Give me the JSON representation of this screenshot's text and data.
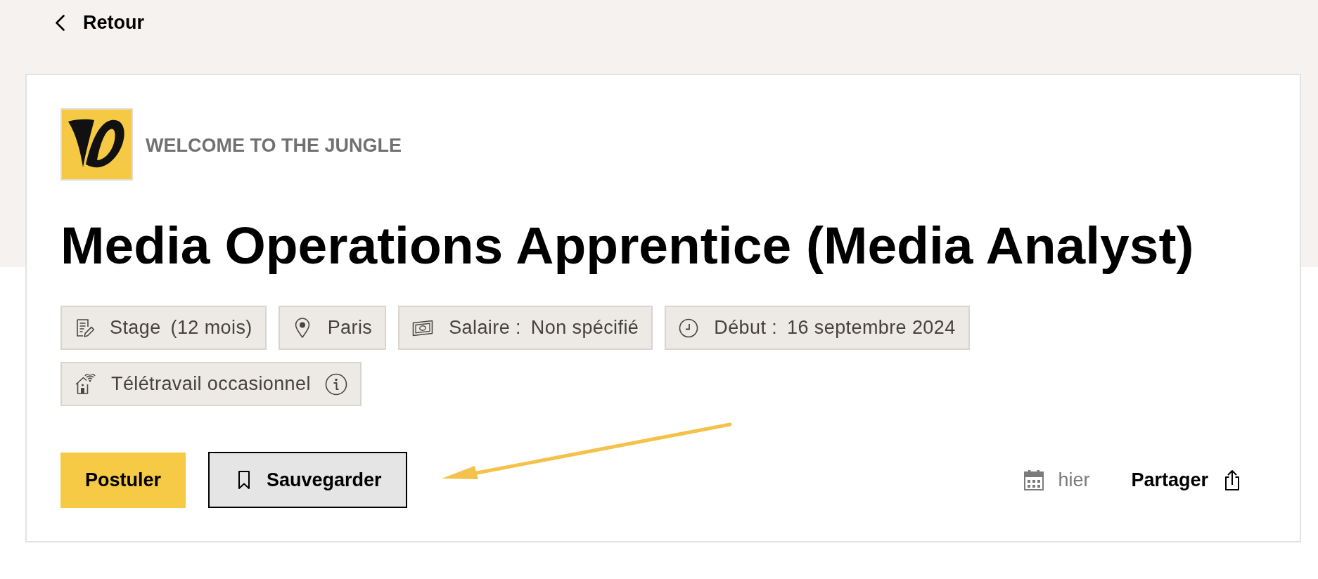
{
  "back_link": {
    "label": "Retour"
  },
  "company": {
    "name": "WELCOME TO THE JUNGLE"
  },
  "job": {
    "title": "Media Operations Apprentice (Media Analyst)"
  },
  "tags": [
    {
      "kind": "contract",
      "label": "Stage",
      "value": "(12 mois)"
    },
    {
      "kind": "location",
      "label": "Paris"
    },
    {
      "kind": "salary",
      "label": "Salaire :",
      "value": "Non spécifié"
    },
    {
      "kind": "start_date",
      "label": "Début :",
      "value": "16 septembre 2024"
    },
    {
      "kind": "remote",
      "label": "Télétravail occasionnel",
      "info": true
    }
  ],
  "actions": {
    "apply_button": {
      "label": "Postuler"
    },
    "save_button": {
      "label": "Sauvegarder"
    }
  },
  "meta": {
    "posted": "hier",
    "share": {
      "label": "Partager"
    }
  }
}
